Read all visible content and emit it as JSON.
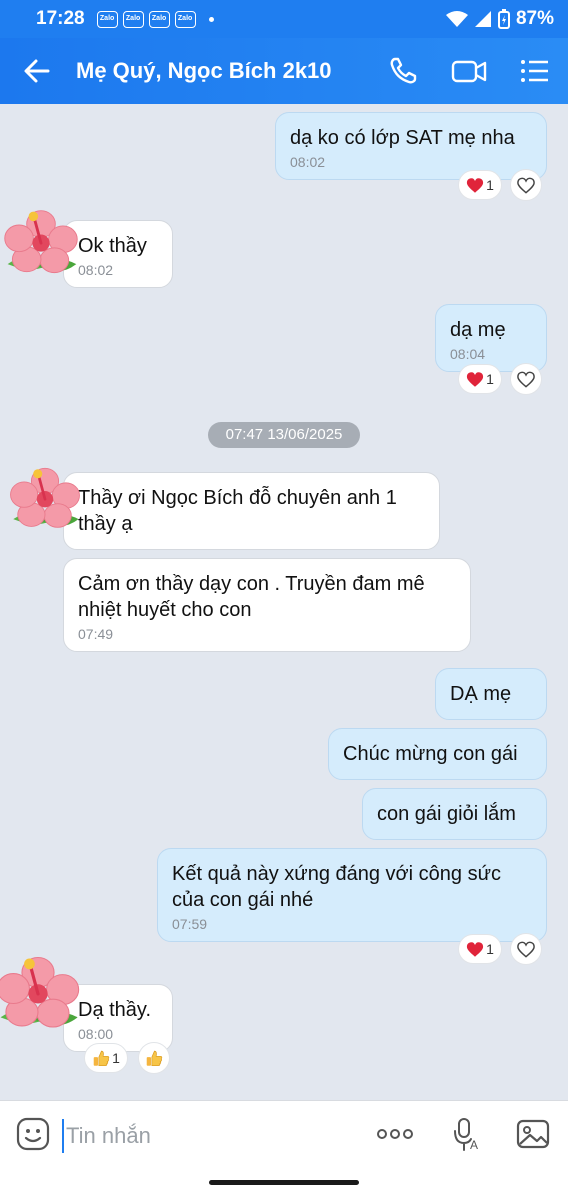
{
  "status_bar": {
    "time": "17:28",
    "app_badges": [
      "Zalo",
      "Zalo",
      "Zalo",
      "Zalo"
    ],
    "battery": "87%"
  },
  "header": {
    "title": "Mẹ Quý, Ngọc Bích 2k10",
    "icons": [
      "back-arrow-icon",
      "phone-icon",
      "video-call-icon",
      "menu-icon"
    ]
  },
  "messages": [
    {
      "dir": "out",
      "text": "dạ ko có lớp SAT mẹ nha",
      "time": "08:02",
      "reaction": "❤",
      "reaction_count": "1"
    },
    {
      "dir": "in",
      "text": "Ok thầy",
      "time": "08:02"
    },
    {
      "dir": "out",
      "text": "dạ mẹ",
      "time": "08:04",
      "reaction": "❤",
      "reaction_count": "1"
    },
    {
      "dir": "in",
      "text": "Thầy ơi Ngọc Bích đỗ chuyên anh 1 thầy ạ"
    },
    {
      "dir": "in",
      "text": "Cảm ơn thầy dạy con . Truyền đam mê nhiệt huyết cho con",
      "time": "07:49"
    },
    {
      "dir": "out",
      "text": "DẠ mẹ"
    },
    {
      "dir": "out",
      "text": "Chúc mừng con gái"
    },
    {
      "dir": "out",
      "text": "con gái giỏi lắm"
    },
    {
      "dir": "out",
      "text": "Kết quả này xứng đáng với công sức của con gái nhé",
      "time": "07:59",
      "reaction": "❤",
      "reaction_count": "1"
    },
    {
      "dir": "in",
      "text": "Dạ thầy.",
      "time": "08:00",
      "reaction": "👍",
      "reaction_count": "1"
    }
  ],
  "date_separator": "07:47 13/06/2025",
  "input_bar": {
    "placeholder": "Tin nhắn",
    "icons": [
      "emoji-sticker-icon",
      "more-options-icon",
      "voice-to-text-icon",
      "image-icon"
    ]
  },
  "colors": {
    "header": "#1f7ef0",
    "background": "#e2e7ef",
    "outgoing_bubble": "#d5ecfc",
    "incoming_bubble": "#ffffff",
    "heart": "#e0243a"
  }
}
